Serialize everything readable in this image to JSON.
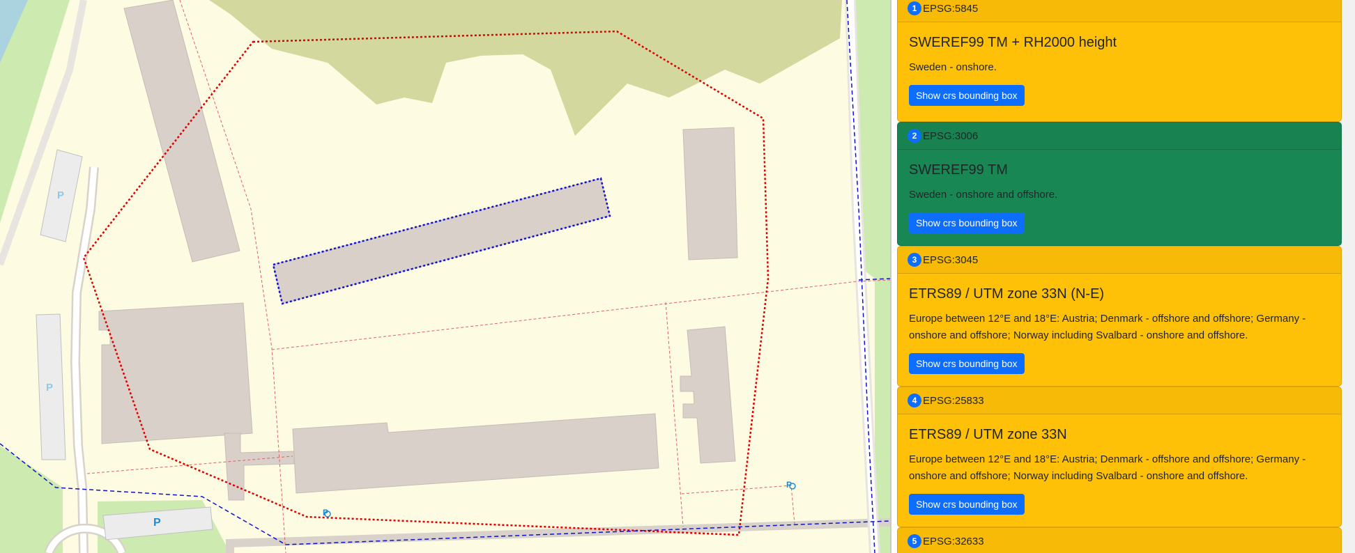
{
  "map": {
    "parking_label": "P",
    "bus_stop_label": "P",
    "colors": {
      "background": "#fdfbe1",
      "building": "#d9d0c9",
      "building_edge": "#c5bcb6",
      "grass": "#cdebb0",
      "wood": "#d3d89e",
      "parking": "#ececec",
      "road": "#ffffff",
      "crs_red": "#e00000",
      "crs_blue": "#1010d0"
    }
  },
  "results": [
    {
      "index": "1",
      "code": "EPSG:5845",
      "title": "SWEREF99 TM + RH2000 height",
      "description": "Sweden - onshore.",
      "button_label": "Show crs bounding box",
      "color": "#ffc107"
    },
    {
      "index": "2",
      "code": "EPSG:3006",
      "title": "SWEREF99 TM",
      "description": "Sweden - onshore and offshore.",
      "button_label": "Show crs bounding box",
      "color": "#198754"
    },
    {
      "index": "3",
      "code": "EPSG:3045",
      "title": "ETRS89 / UTM zone 33N (N-E)",
      "description": "Europe between 12°E and 18°E: Austria; Denmark - offshore and offshore; Germany - onshore and offshore; Norway including Svalbard - onshore and offshore.",
      "button_label": "Show crs bounding box",
      "color": "#ffc107"
    },
    {
      "index": "4",
      "code": "EPSG:25833",
      "title": "ETRS89 / UTM zone 33N",
      "description": "Europe between 12°E and 18°E: Austria; Denmark - offshore and offshore; Germany - onshore and offshore; Norway including Svalbard - onshore and offshore.",
      "button_label": "Show crs bounding box",
      "color": "#ffc107"
    },
    {
      "index": "5",
      "code": "EPSG:32633",
      "title": "",
      "description": "",
      "button_label": "",
      "color": "#ffc107"
    }
  ]
}
